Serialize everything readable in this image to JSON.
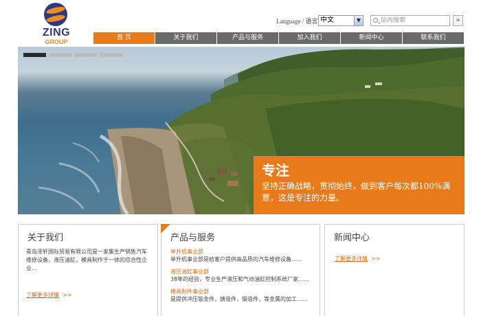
{
  "logo": {
    "name": "ZING",
    "sub": "GROUP"
  },
  "header": {
    "language_label": "Language / 语言",
    "language_value": "中文",
    "search_placeholder": "站内搜索",
    "search_go": "»"
  },
  "nav": [
    {
      "label": "首 页"
    },
    {
      "label": "关于我们"
    },
    {
      "label": "产品与服务"
    },
    {
      "label": "加入我们"
    },
    {
      "label": "新闻中心"
    },
    {
      "label": "联系我们"
    }
  ],
  "banner": {
    "caption_title": "专注",
    "caption_text": "坚持正确战略，贯彻始终，做到客户每次都100%满意，这是专注的力量。",
    "slide_count": 4,
    "active_slide": 1
  },
  "panels": {
    "about": {
      "title": "关于我们",
      "text": "青岛泽轩国际贸易有限公司是一家集生产销售汽车维修设备，液压油缸，模具制作于一体的综合性企业…",
      "more": "了解更多详情",
      "arrow": ">>"
    },
    "products": {
      "title": "产品与服务",
      "items": [
        {
          "head": "举升机事业部",
          "desc": "举升机事业部是给客户提供高品质的汽车维修设备……"
        },
        {
          "head": "液压油缸事业部",
          "desc": "38年的经验，专业生产液压和气动油缸控制系统厂家……"
        },
        {
          "head": "模具制件事业部",
          "desc": "是提供冲压钣金件，铸造件，锻造件，等金属的加工……"
        }
      ]
    },
    "news": {
      "title": "新闻中心",
      "more": "了解更多详情",
      "arrow": ">>"
    }
  },
  "colors": {
    "accent": "#e87a19",
    "nav_bg": "#6a6a6a",
    "brand_blue": "#2d3a80"
  }
}
